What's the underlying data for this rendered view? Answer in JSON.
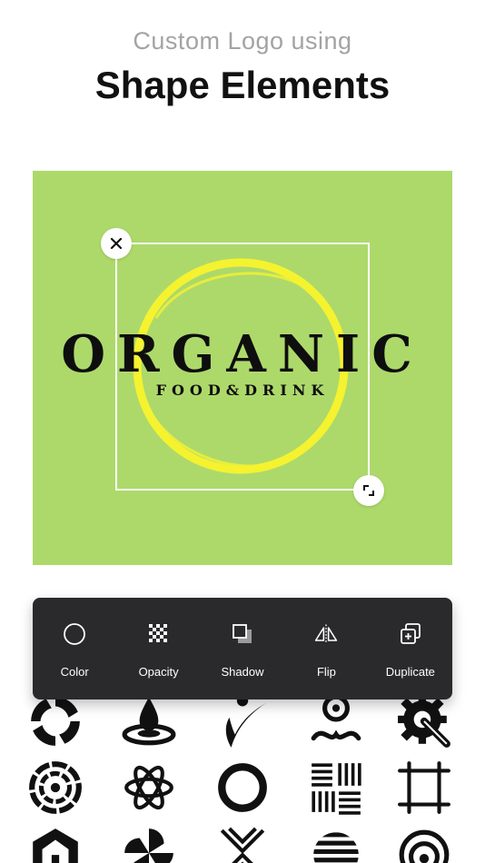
{
  "header": {
    "subtitle": "Custom Logo using",
    "title": "Shape Elements"
  },
  "canvas": {
    "background": "#add96b",
    "ring_color": "#f5f230",
    "logo_main": "ORGANIC",
    "logo_sub": "FOOD&DRINK"
  },
  "toolbar": {
    "items": [
      {
        "label": "Color",
        "icon": "circle-outline-icon"
      },
      {
        "label": "Opacity",
        "icon": "checkerboard-icon"
      },
      {
        "label": "Shadow",
        "icon": "shadow-squares-icon"
      },
      {
        "label": "Flip",
        "icon": "flip-icon"
      },
      {
        "label": "Duplicate",
        "icon": "duplicate-icon"
      }
    ]
  },
  "shapes": [
    "spiral-burst-icon",
    "water-drop-icon",
    "swoosh-figure-icon",
    "meditation-figure-icon",
    "gear-wrench-icon",
    "concentric-segments-icon",
    "atom-flower-icon",
    "brush-ring-icon",
    "hatched-squares-icon",
    "sketch-frame-icon",
    "hexagon-house-icon",
    "pinwheel-icon",
    "chevron-cross-icon",
    "striped-globe-icon",
    "spiral-target-icon"
  ]
}
